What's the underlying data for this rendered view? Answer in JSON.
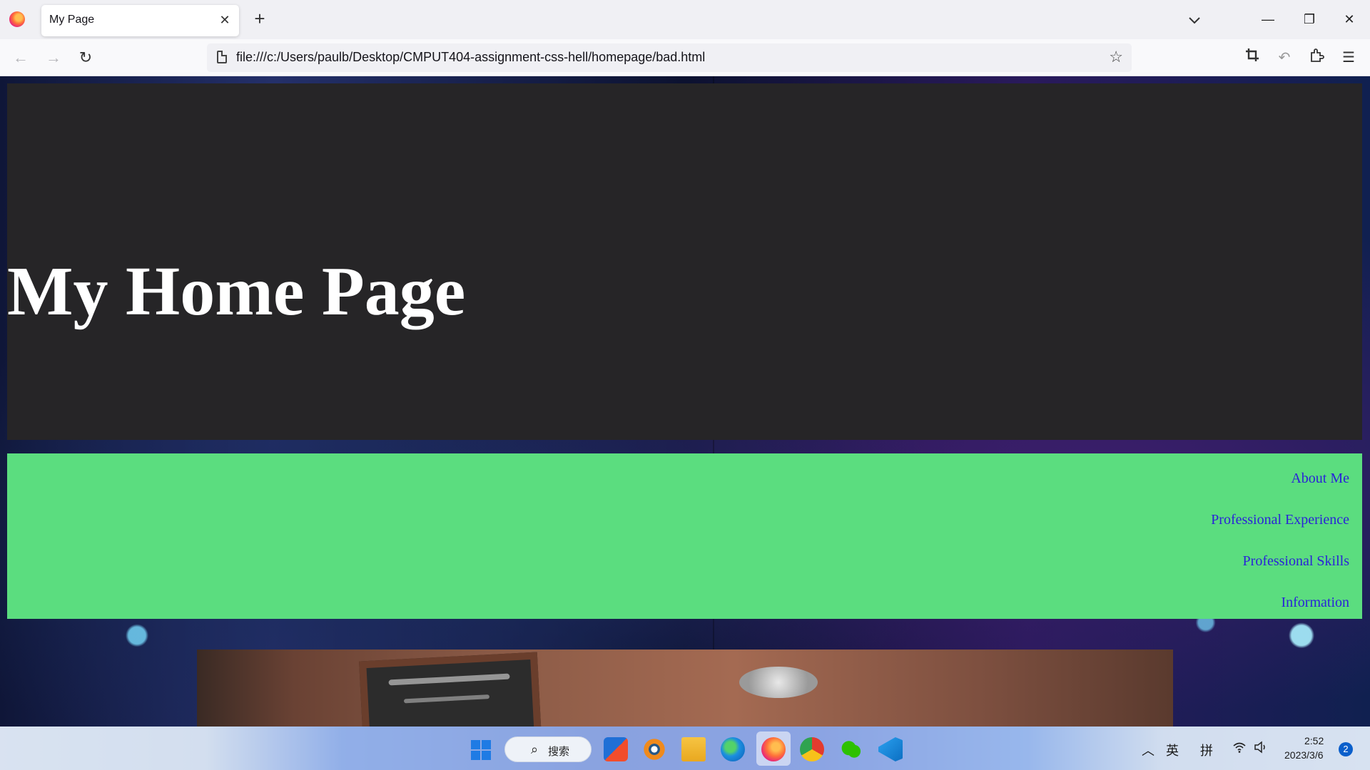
{
  "browser": {
    "tab_title": "My Page",
    "tab_close": "✕",
    "new_tab": "+",
    "url": "file:///c:/Users/paulb/Desktop/CMPUT404-assignment-css-hell/homepage/bad.html",
    "window_controls": {
      "minimize": "—",
      "restore": "❐",
      "close": "✕"
    },
    "icons": [
      "firefox-icon",
      "back-icon",
      "forward-icon",
      "reload-icon",
      "page-icon",
      "bookmark-star-icon",
      "screenshot-icon",
      "undo-icon",
      "extensions-icon",
      "menu-icon"
    ]
  },
  "page": {
    "title": "My Home Page",
    "nav_links": [
      "About Me",
      "Professional Experience",
      "Professional Skills",
      "Information"
    ],
    "colors": {
      "header_bg": "#262527",
      "nav_bg": "#5bdd7f",
      "link": "#2a23d8",
      "title": "#ffffff"
    }
  },
  "taskbar": {
    "search_label": "搜索",
    "tray_ime_1": "英",
    "tray_ime_2": "拼",
    "time": "2:52",
    "date": "2023/3/6",
    "notification_count": "2",
    "apps": [
      "windows-start-icon",
      "store-icon",
      "blender-icon",
      "file-explorer-icon",
      "edge-icon",
      "firefox-icon",
      "chrome-icon",
      "wechat-icon",
      "vscode-icon"
    ]
  }
}
